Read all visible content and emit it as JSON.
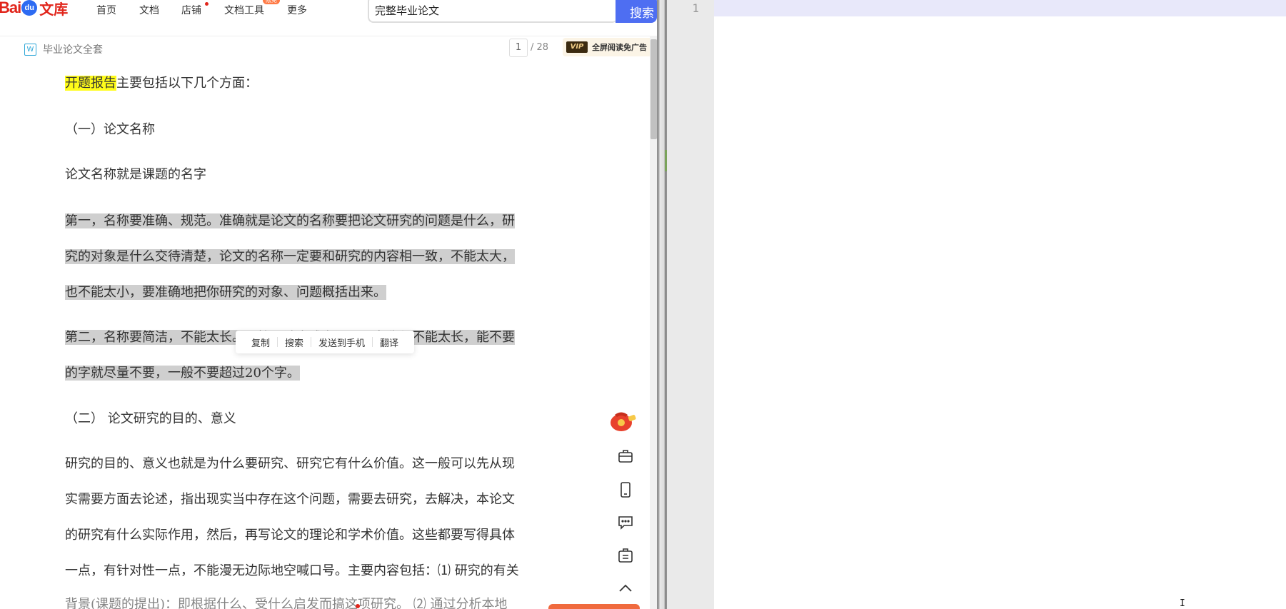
{
  "nav": {
    "logo": {
      "bai": "Bai",
      "du": "du",
      "ku": "文库"
    },
    "items": [
      "首页",
      "文档",
      "店铺",
      "文档工具",
      "更多"
    ],
    "tools_badge": "限免",
    "search_value": "完整毕业论文",
    "search_button": "搜索"
  },
  "doc": {
    "icon_letter": "W",
    "title": "毕业论文全套",
    "page_current": "1",
    "page_total": "/ 28",
    "vip_logo": "VIP",
    "vip_text": "全屏阅读免广告"
  },
  "content": {
    "p1_highlight": "开题报告",
    "p1_rest": "主要包括以下几个方面：",
    "h1": "（一）论文名称",
    "p2": "论文名称就是课题的名字",
    "p3_lines": [
      "第一，名称要准确、规范。准确就是论文的名称要把论文研究的问题是什么，研",
      "究的对象是什么交待清楚，论文的名称一定要和研究的内容相一致，不能太大，",
      "也不能太小，要准确地把你研究的对象、问题概括出来。"
    ],
    "p4_lines": [
      "第二，名称要简洁，不能太长。不管是论文或者课题，名称都不能太长，能不要",
      "的字就尽量不要，一般不要超过20个字。"
    ],
    "h2": "（二）  论文研究的目的、意义",
    "p5_lines": [
      "研究的目的、意义也就是为什么要研究、研究它有什么价值。这一般可以先从现",
      "实需要方面去论述，指出现实当中存在这个问题，需要去研究，去解决，本论文",
      "的研究有什么实际作用，然后，再写论文的理论和学术价值。这些都要写得具体",
      "一点，有针对性一点，不能漫无边际地空喊口号。主要内容包括：⑴ 研究的有关",
      "背景(课题的提出)：即根据什么、受什么启发而搞这项研究。 ⑵ 通过分析本地"
    ]
  },
  "context_menu": [
    "复制",
    "搜索",
    "发送到手机",
    "翻译"
  ],
  "side_tools": [
    "redpacket-icon",
    "briefcase-icon",
    "phone-icon",
    "comment-icon",
    "clipboard-icon",
    "chevron-up-icon"
  ],
  "editor": {
    "line_number": "1",
    "cursor_glyph": "I"
  },
  "colors": {
    "search_blue": "#4e6ef2",
    "logo_red": "#e1251b",
    "highlight_yellow": "#fffc1a",
    "selection_gray": "#cfcfcf",
    "editor_current_line": "#e8e8fa"
  }
}
